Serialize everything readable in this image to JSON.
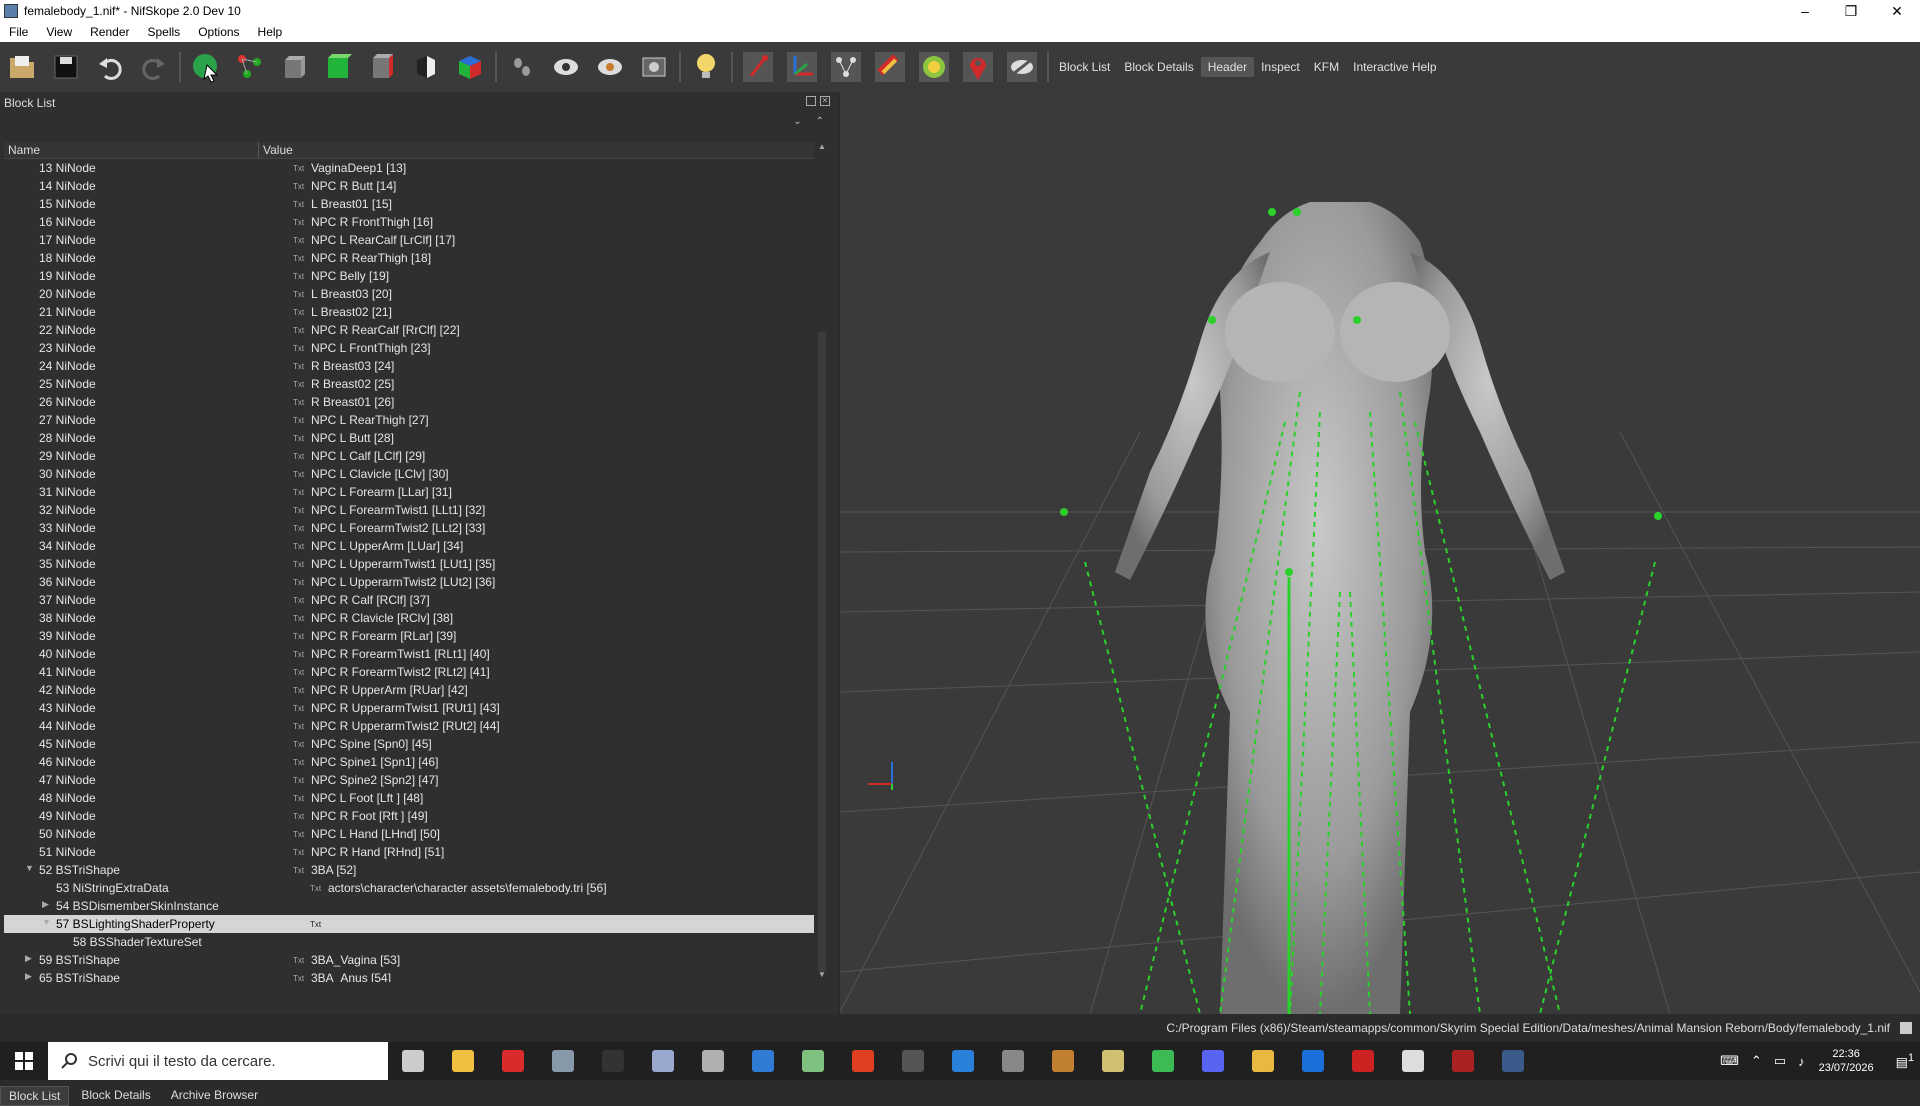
{
  "window": {
    "title": "femalebody_1.nif* - NifSkope 2.0 Dev 10",
    "controls": [
      "–",
      "❐",
      "✕"
    ]
  },
  "menu": [
    "File",
    "View",
    "Render",
    "Spells",
    "Options",
    "Help"
  ],
  "toolbar": {
    "icons": [
      "load-icon",
      "save-icon",
      "undo-icon",
      "redo-icon",
      "select-object-icon",
      "select-vertex-icon",
      "view-front-icon",
      "view-top-icon",
      "view-side-icon",
      "view-walk-icon",
      "view-user-icon",
      "show-nodes-icon",
      "show-hidden-icon",
      "show-markers-icon",
      "screenshot-icon",
      "lighting-icon",
      "show-axes-icon",
      "show-grid-icon",
      "show-skeleton-icon",
      "show-constraints-icon",
      "show-havok-icon",
      "show-markers-icon-2",
      "show-invisible-icon"
    ],
    "text_buttons": [
      "Block List",
      "Block Details",
      "Header",
      "Inspect",
      "KFM",
      "Interactive Help"
    ],
    "active_text_button": "Header"
  },
  "block_list": {
    "title": "Block List",
    "columns": {
      "name": "Name",
      "value": "Value"
    },
    "rows": [
      {
        "name": "13 NiNode",
        "value": "VaginaDeep1 [13]",
        "indent": 1,
        "icon": "Txt"
      },
      {
        "name": "14 NiNode",
        "value": "NPC R Butt [14]",
        "indent": 1,
        "icon": "Txt"
      },
      {
        "name": "15 NiNode",
        "value": "L Breast01 [15]",
        "indent": 1,
        "icon": "Txt"
      },
      {
        "name": "16 NiNode",
        "value": "NPC R FrontThigh [16]",
        "indent": 1,
        "icon": "Txt"
      },
      {
        "name": "17 NiNode",
        "value": "NPC L RearCalf [LrClf] [17]",
        "indent": 1,
        "icon": "Txt"
      },
      {
        "name": "18 NiNode",
        "value": "NPC R RearThigh [18]",
        "indent": 1,
        "icon": "Txt"
      },
      {
        "name": "19 NiNode",
        "value": "NPC Belly [19]",
        "indent": 1,
        "icon": "Txt"
      },
      {
        "name": "20 NiNode",
        "value": "L Breast03 [20]",
        "indent": 1,
        "icon": "Txt"
      },
      {
        "name": "21 NiNode",
        "value": "L Breast02 [21]",
        "indent": 1,
        "icon": "Txt"
      },
      {
        "name": "22 NiNode",
        "value": "NPC R RearCalf [RrClf] [22]",
        "indent": 1,
        "icon": "Txt"
      },
      {
        "name": "23 NiNode",
        "value": "NPC L FrontThigh [23]",
        "indent": 1,
        "icon": "Txt"
      },
      {
        "name": "24 NiNode",
        "value": "R Breast03 [24]",
        "indent": 1,
        "icon": "Txt"
      },
      {
        "name": "25 NiNode",
        "value": "R Breast02 [25]",
        "indent": 1,
        "icon": "Txt"
      },
      {
        "name": "26 NiNode",
        "value": "R Breast01 [26]",
        "indent": 1,
        "icon": "Txt"
      },
      {
        "name": "27 NiNode",
        "value": "NPC L RearThigh [27]",
        "indent": 1,
        "icon": "Txt"
      },
      {
        "name": "28 NiNode",
        "value": "NPC L Butt [28]",
        "indent": 1,
        "icon": "Txt"
      },
      {
        "name": "29 NiNode",
        "value": "NPC L Calf [LClf] [29]",
        "indent": 1,
        "icon": "Txt"
      },
      {
        "name": "30 NiNode",
        "value": "NPC L Clavicle [LClv] [30]",
        "indent": 1,
        "icon": "Txt"
      },
      {
        "name": "31 NiNode",
        "value": "NPC L Forearm [LLar] [31]",
        "indent": 1,
        "icon": "Txt"
      },
      {
        "name": "32 NiNode",
        "value": "NPC L ForearmTwist1 [LLt1] [32]",
        "indent": 1,
        "icon": "Txt"
      },
      {
        "name": "33 NiNode",
        "value": "NPC L ForearmTwist2 [LLt2] [33]",
        "indent": 1,
        "icon": "Txt"
      },
      {
        "name": "34 NiNode",
        "value": "NPC L UpperArm [LUar] [34]",
        "indent": 1,
        "icon": "Txt"
      },
      {
        "name": "35 NiNode",
        "value": "NPC L UpperarmTwist1 [LUt1] [35]",
        "indent": 1,
        "icon": "Txt"
      },
      {
        "name": "36 NiNode",
        "value": "NPC L UpperarmTwist2 [LUt2] [36]",
        "indent": 1,
        "icon": "Txt"
      },
      {
        "name": "37 NiNode",
        "value": "NPC R Calf [RClf] [37]",
        "indent": 1,
        "icon": "Txt"
      },
      {
        "name": "38 NiNode",
        "value": "NPC R Clavicle [RClv] [38]",
        "indent": 1,
        "icon": "Txt"
      },
      {
        "name": "39 NiNode",
        "value": "NPC R Forearm [RLar] [39]",
        "indent": 1,
        "icon": "Txt"
      },
      {
        "name": "40 NiNode",
        "value": "NPC R ForearmTwist1 [RLt1] [40]",
        "indent": 1,
        "icon": "Txt"
      },
      {
        "name": "41 NiNode",
        "value": "NPC R ForearmTwist2 [RLt2] [41]",
        "indent": 1,
        "icon": "Txt"
      },
      {
        "name": "42 NiNode",
        "value": "NPC R UpperArm [RUar] [42]",
        "indent": 1,
        "icon": "Txt"
      },
      {
        "name": "43 NiNode",
        "value": "NPC R UpperarmTwist1 [RUt1] [43]",
        "indent": 1,
        "icon": "Txt"
      },
      {
        "name": "44 NiNode",
        "value": "NPC R UpperarmTwist2 [RUt2] [44]",
        "indent": 1,
        "icon": "Txt"
      },
      {
        "name": "45 NiNode",
        "value": "NPC Spine [Spn0] [45]",
        "indent": 1,
        "icon": "Txt"
      },
      {
        "name": "46 NiNode",
        "value": "NPC Spine1 [Spn1] [46]",
        "indent": 1,
        "icon": "Txt"
      },
      {
        "name": "47 NiNode",
        "value": "NPC Spine2 [Spn2] [47]",
        "indent": 1,
        "icon": "Txt"
      },
      {
        "name": "48 NiNode",
        "value": "NPC L Foot [Lft ] [48]",
        "indent": 1,
        "icon": "Txt"
      },
      {
        "name": "49 NiNode",
        "value": "NPC R Foot [Rft ] [49]",
        "indent": 1,
        "icon": "Txt"
      },
      {
        "name": "50 NiNode",
        "value": "NPC L Hand [LHnd] [50]",
        "indent": 1,
        "icon": "Txt"
      },
      {
        "name": "51 NiNode",
        "value": "NPC R Hand [RHnd] [51]",
        "indent": 1,
        "icon": "Txt"
      },
      {
        "name": "52 BSTriShape",
        "value": "3BA [52]",
        "indent": 1,
        "icon": "Txt",
        "arrow": "▼"
      },
      {
        "name": "53 NiStringExtraData",
        "value": "actors\\character\\character assets\\femalebody.tri [56]",
        "indent": 2,
        "icon": "Txt"
      },
      {
        "name": "54 BSDismemberSkinInstance",
        "value": "",
        "indent": 2,
        "arrow": "▶"
      },
      {
        "name": "57 BSLightingShaderProperty",
        "value": "",
        "indent": 2,
        "icon": "Txt",
        "arrow": "▼",
        "selected": true
      },
      {
        "name": "58 BSShaderTextureSet",
        "value": "",
        "indent": 3
      },
      {
        "name": "59 BSTriShape",
        "value": "3BA_Vagina [53]",
        "indent": 1,
        "icon": "Txt",
        "arrow": "▶"
      },
      {
        "name": "65 BSTriShape",
        "value": "3BA_Anus [54]",
        "indent": 1,
        "icon": "Txt",
        "arrow": "▶"
      }
    ]
  },
  "bottom_tabs": [
    "Block List",
    "Block Details",
    "Archive Browser"
  ],
  "active_bottom_tab": "Block List",
  "status": {
    "path": "C:/Program Files (x86)/Steam/steamapps/common/Skyrim Special Edition/Data/meshes/Animal Mansion Reborn/Body/femalebody_1.nif"
  },
  "taskbar": {
    "search_placeholder": "Scrivi qui il testo da cercare.",
    "apps": [
      {
        "name": "task-view-icon",
        "color": "#cccccc"
      },
      {
        "name": "file-explorer-icon",
        "color": "#f0c040"
      },
      {
        "name": "opera-icon",
        "color": "#d92b2b"
      },
      {
        "name": "nifskope-icon",
        "color": "#8899aa"
      },
      {
        "name": "mod-manager-icon",
        "color": "#333333"
      },
      {
        "name": "feather-icon",
        "color": "#9aa8d0"
      },
      {
        "name": "tool-icon",
        "color": "#b0b0b0"
      },
      {
        "name": "app-blue-icon",
        "color": "#2f7bd6"
      },
      {
        "name": "notepad-icon",
        "color": "#7fc27f"
      },
      {
        "name": "filezilla-icon",
        "color": "#e04020"
      },
      {
        "name": "arrow-app-icon",
        "color": "#555555"
      },
      {
        "name": "window-app-icon",
        "color": "#2a7fd8"
      },
      {
        "name": "terminal-icon",
        "color": "#888888"
      },
      {
        "name": "figure-app-icon",
        "color": "#c08030"
      },
      {
        "name": "map-app-icon",
        "color": "#d0c070"
      },
      {
        "name": "chrome-icon",
        "color": "#3cba54"
      },
      {
        "name": "discord-icon",
        "color": "#5865f2"
      },
      {
        "name": "folder-icon",
        "color": "#e8b840"
      },
      {
        "name": "photoshop-icon",
        "color": "#1a6fd8"
      },
      {
        "name": "red-app-icon",
        "color": "#cc2222"
      },
      {
        "name": "grid-app-icon",
        "color": "#dddddd"
      },
      {
        "name": "record-app-icon",
        "color": "#aa2222"
      },
      {
        "name": "steam-icon",
        "color": "#3a5a8a"
      }
    ],
    "time": "22:36",
    "date": "23/07/2026",
    "notification_count": "1"
  }
}
